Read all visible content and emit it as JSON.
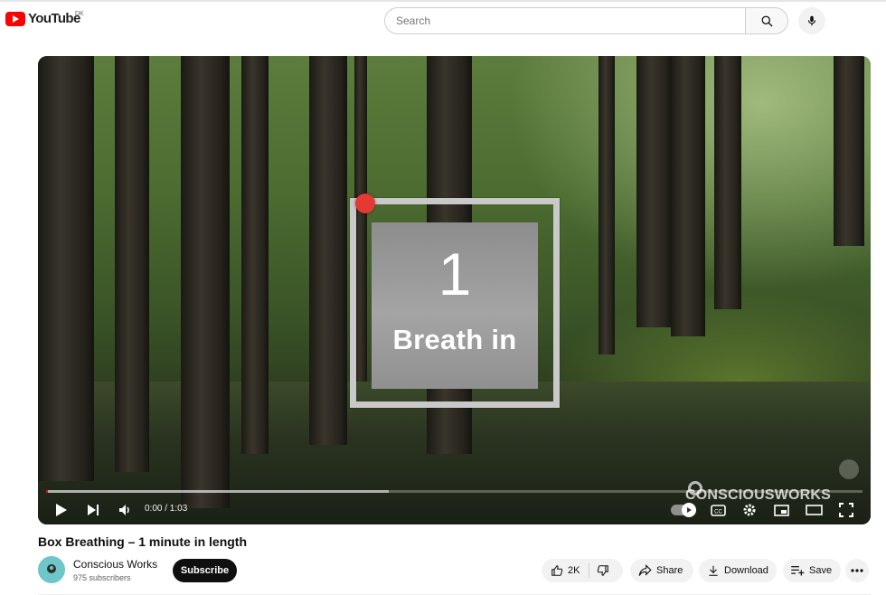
{
  "header": {
    "logo_text": "YouTube",
    "country_code": "DK",
    "search_placeholder": "Search"
  },
  "player": {
    "overlay_number": "1",
    "overlay_label": "Breath in",
    "watermark": "CONSCIOUSWORKS",
    "time_display": "0:00 / 1:03",
    "progress_played_fraction": 0.0,
    "progress_loaded_fraction": 0.42
  },
  "video": {
    "title": "Box Breathing – 1 minute in length"
  },
  "channel": {
    "name": "Conscious Works",
    "subscribers": "975 subscribers",
    "subscribe_label": "Subscribe",
    "avatar_color": "#6ec6c8"
  },
  "actions": {
    "like_count": "2K",
    "share_label": "Share",
    "download_label": "Download",
    "save_label": "Save"
  },
  "colors": {
    "brand_red": "#ff0000",
    "subscribe_bg": "#0f0f0f",
    "breath_dot": "#e53935"
  },
  "icons": [
    "youtube-logo-icon",
    "search-icon",
    "mic-icon",
    "play-icon",
    "next-icon",
    "volume-icon",
    "autoplay-toggle-icon",
    "captions-icon",
    "settings-icon",
    "miniplayer-icon",
    "theater-icon",
    "fullscreen-icon",
    "like-icon",
    "dislike-icon",
    "share-icon",
    "download-icon",
    "save-icon",
    "more-icon"
  ]
}
